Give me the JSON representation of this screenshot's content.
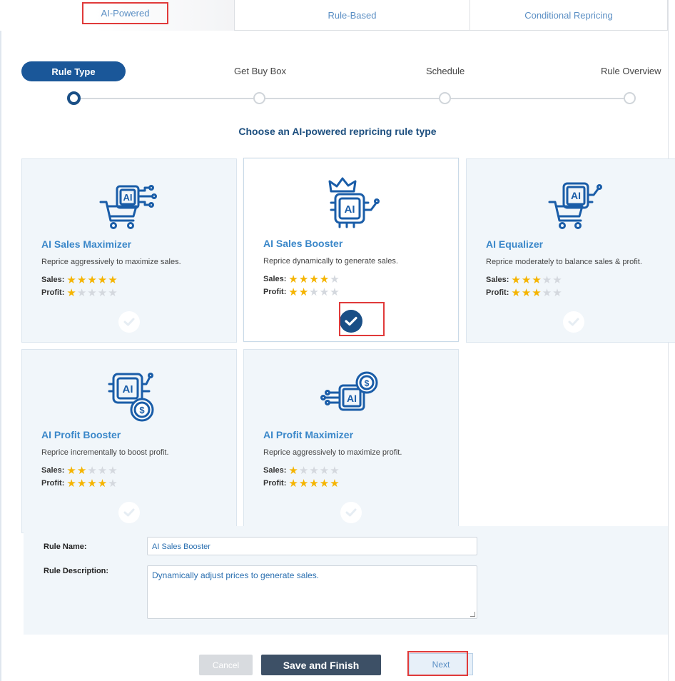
{
  "tabs": [
    {
      "label": "AI-Powered"
    },
    {
      "label": "Rule-Based"
    },
    {
      "label": "Conditional Repricing"
    }
  ],
  "stepper": {
    "steps": [
      {
        "label": "Rule Type"
      },
      {
        "label": "Get Buy Box"
      },
      {
        "label": "Schedule"
      },
      {
        "label": "Rule Overview"
      }
    ],
    "active_step": 1
  },
  "subtitle": "Choose an AI-powered repricing rule type",
  "rating_labels": {
    "sales": "Sales:",
    "profit": "Profit:"
  },
  "cards": [
    {
      "title": "AI Sales Maximizer",
      "description": "Reprice aggressively to maximize sales.",
      "sales_stars": 5,
      "profit_stars": 1,
      "icon": "ai-cart-icon",
      "selected": false
    },
    {
      "title": "AI Sales Booster",
      "description": "Reprice dynamically to generate sales.",
      "sales_stars": 4,
      "profit_stars": 2,
      "icon": "ai-crown-icon",
      "selected": true
    },
    {
      "title": "AI Equalizer",
      "description": "Reprice moderately to balance sales & profit.",
      "sales_stars": 3,
      "profit_stars": 3,
      "icon": "ai-cart-chip-icon",
      "selected": false
    },
    {
      "title": "AI Profit Booster",
      "description": "Reprice incrementally to boost profit.",
      "sales_stars": 2,
      "profit_stars": 4,
      "icon": "ai-dollar-icon",
      "selected": false
    },
    {
      "title": "AI Profit Maximizer",
      "description": "Reprice aggressively to maximize profit.",
      "sales_stars": 1,
      "profit_stars": 5,
      "icon": "ai-dollar-circuit-icon",
      "selected": false
    }
  ],
  "form": {
    "rule_name_label": "Rule Name:",
    "rule_name_value": "AI Sales Booster",
    "rule_description_label": "Rule Description:",
    "rule_description_value": "Dynamically adjust prices to generate sales."
  },
  "buttons": {
    "cancel": "Cancel",
    "save_finish": "Save and Finish",
    "next": "Next"
  },
  "colors": {
    "primary": "#1a5799",
    "link_blue": "#3a87c9",
    "star_on": "#f5b400",
    "star_off": "#d4d8de",
    "highlight_red": "#e03a3a"
  }
}
